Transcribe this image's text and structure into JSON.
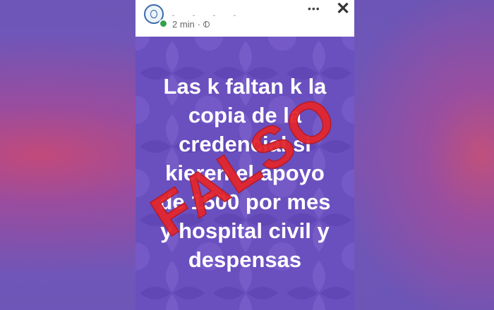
{
  "post": {
    "timestamp": "2 min",
    "separator": "·",
    "privacy_icon": "globe-icon",
    "more_icon": "ellipsis-icon",
    "close_icon": "close-icon",
    "close_symbol": "✕",
    "more_symbol": "•••"
  },
  "image": {
    "lines": [
      "Las k faltan k la",
      "copia de la",
      "credencial si",
      "kieren el apoyo",
      "de 1500 por mes",
      "y hospital civil y",
      "despensas"
    ],
    "stamp_text": "FALSO",
    "stamp_color": "#e3262e",
    "background_color": "#6a4fbf"
  }
}
